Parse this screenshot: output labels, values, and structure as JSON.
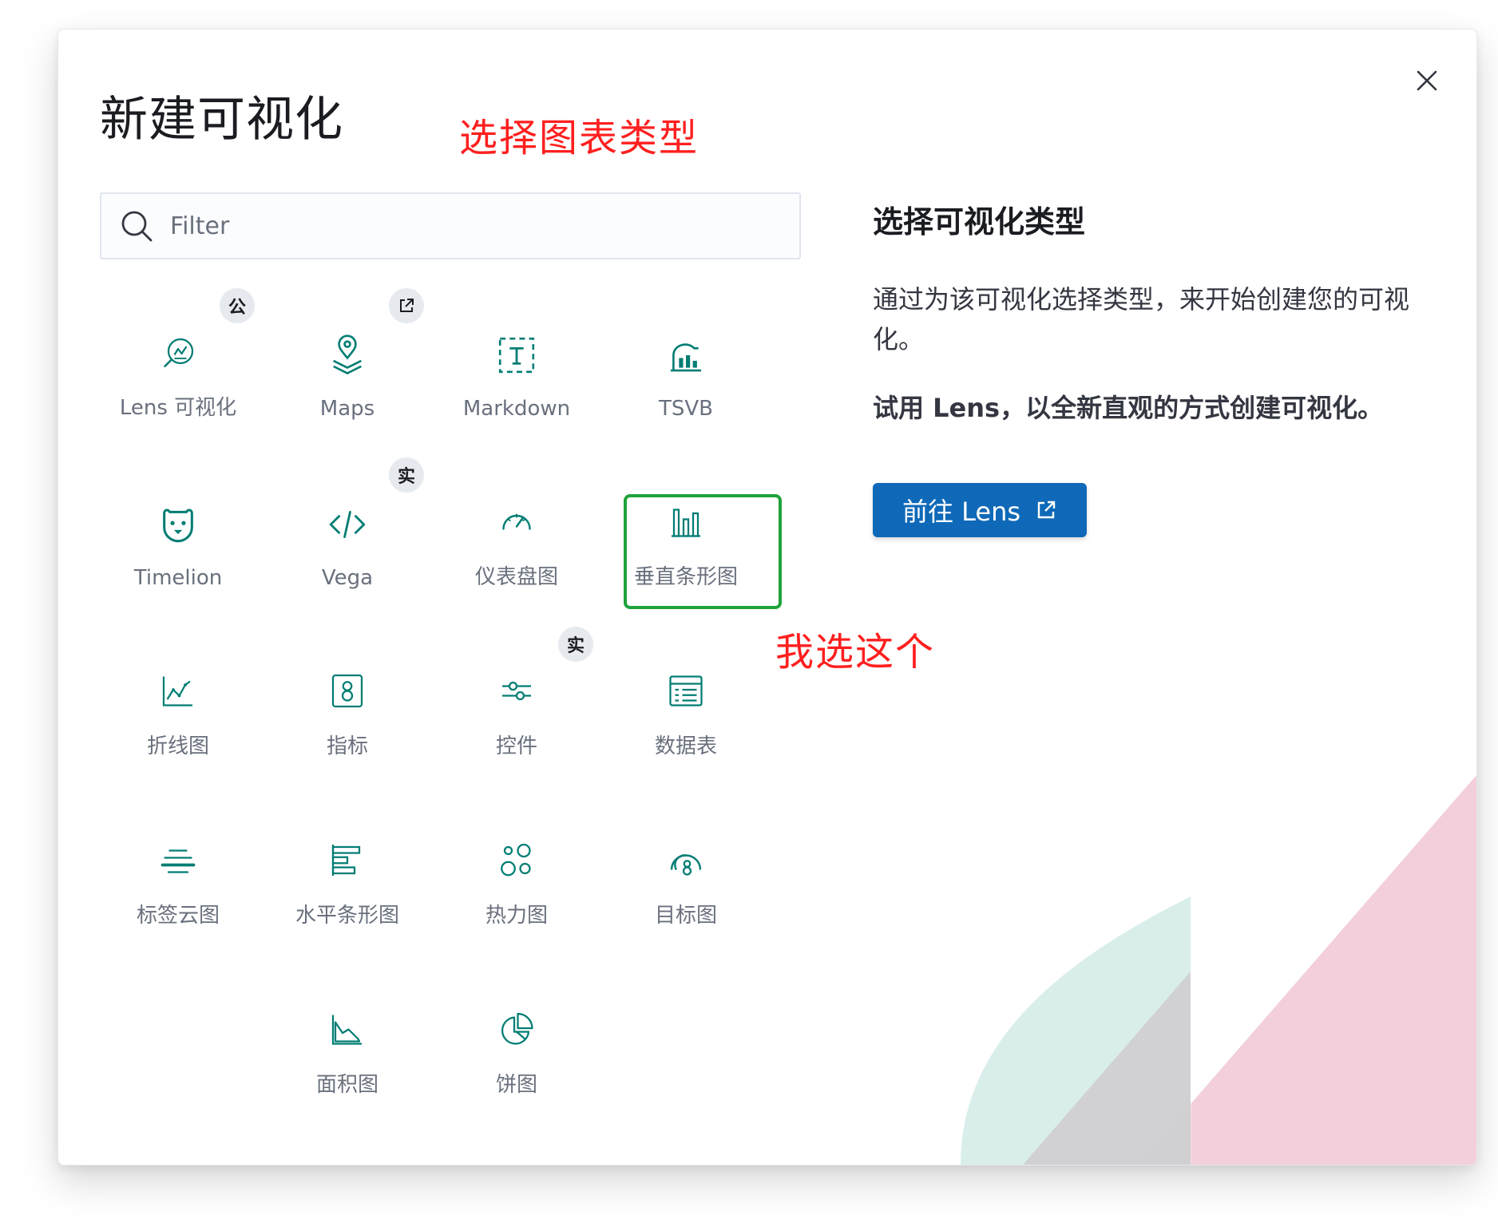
{
  "modal": {
    "title": "新建可视化",
    "close_icon": "close-icon"
  },
  "annotations": {
    "choose_chart_type": "选择图表类型",
    "i_choose_this": "我选这个"
  },
  "search": {
    "placeholder": "Filter",
    "value": ""
  },
  "visualizations": [
    {
      "label": "Lens 可视化",
      "icon": "lens-icon",
      "badge": "公"
    },
    {
      "label": "Maps",
      "icon": "maps-icon",
      "badge": "external-link-icon"
    },
    {
      "label": "Markdown",
      "icon": "markdown-icon"
    },
    {
      "label": "TSVB",
      "icon": "tsvb-icon"
    },
    {
      "label": "Timelion",
      "icon": "timelion-icon"
    },
    {
      "label": "Vega",
      "icon": "vega-icon",
      "badge": "实"
    },
    {
      "label": "仪表盘图",
      "icon": "gauge-icon"
    },
    {
      "label": "垂直条形图",
      "icon": "vertical-bar-icon",
      "selected": true
    },
    {
      "label": "折线图",
      "icon": "line-chart-icon"
    },
    {
      "label": "指标",
      "icon": "metric-icon"
    },
    {
      "label": "控件",
      "icon": "controls-icon",
      "badge": "实"
    },
    {
      "label": "数据表",
      "icon": "data-table-icon"
    },
    {
      "label": "标签云图",
      "icon": "tag-cloud-icon"
    },
    {
      "label": "水平条形图",
      "icon": "horizontal-bar-icon"
    },
    {
      "label": "热力图",
      "icon": "heatmap-icon"
    },
    {
      "label": "目标图",
      "icon": "goal-icon"
    },
    {
      "label": "面积图",
      "icon": "area-chart-icon"
    },
    {
      "label": "饼图",
      "icon": "pie-chart-icon"
    }
  ],
  "side_panel": {
    "heading": "选择可视化类型",
    "description": "通过为该可视化选择类型，来开始创建您的可视化。",
    "promo": "试用 Lens，以全新直观的方式创建可视化。",
    "button_label": "前往 Lens",
    "button_icon": "external-link-icon"
  },
  "colors": {
    "icon_teal": "#017d73",
    "accent_blue": "#0f69b8",
    "annotation_red": "#ff1f1f",
    "selection_green": "#1fa33a"
  }
}
